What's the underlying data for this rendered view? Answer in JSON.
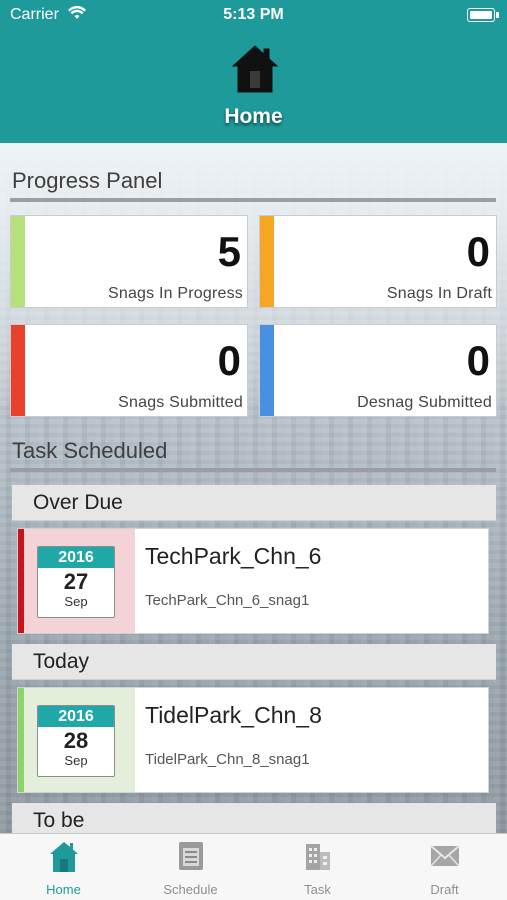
{
  "status_bar": {
    "carrier": "Carrier",
    "time": "5:13 PM",
    "wifi_icon": "wifi-icon",
    "battery_icon": "battery-icon"
  },
  "header": {
    "icon": "home-icon",
    "title": "Home",
    "color": "#1f9a9a"
  },
  "progress_panel": {
    "title": "Progress Panel",
    "cards": [
      {
        "count": "5",
        "label": "Snags In Progress",
        "color": "#b5e07a"
      },
      {
        "count": "0",
        "label": "Snags In Draft",
        "color": "#f5a623"
      },
      {
        "count": "0",
        "label": "Snags Submitted",
        "color": "#e8412c"
      },
      {
        "count": "0",
        "label": "Desnag Submitted",
        "color": "#4a90e2"
      }
    ]
  },
  "task_scheduled": {
    "title": "Task Scheduled",
    "groups": [
      {
        "label": "Over Due",
        "tasks": [
          {
            "year": "2016",
            "day": "27",
            "month": "Sep",
            "title": "TechPark_Chn_6",
            "subtitle": "TechPark_Chn_6_snag1",
            "stripe_color": "#c9141c",
            "date_bg": "#f3d3d6"
          }
        ]
      },
      {
        "label": "Today",
        "tasks": [
          {
            "year": "2016",
            "day": "28",
            "month": "Sep",
            "title": "TidelPark_Chn_8",
            "subtitle": "TidelPark_Chn_8_snag1",
            "stripe_color": "#8ed36a",
            "date_bg": "#e3efdb"
          }
        ]
      },
      {
        "label": "To be",
        "tasks": []
      }
    ]
  },
  "tab_bar": {
    "active": "Home",
    "active_color": "#1f9a9a",
    "tabs": [
      {
        "label": "Home",
        "icon": "home-icon"
      },
      {
        "label": "Schedule",
        "icon": "schedule-icon"
      },
      {
        "label": "Task",
        "icon": "building-icon"
      },
      {
        "label": "Draft",
        "icon": "envelope-icon"
      }
    ]
  }
}
